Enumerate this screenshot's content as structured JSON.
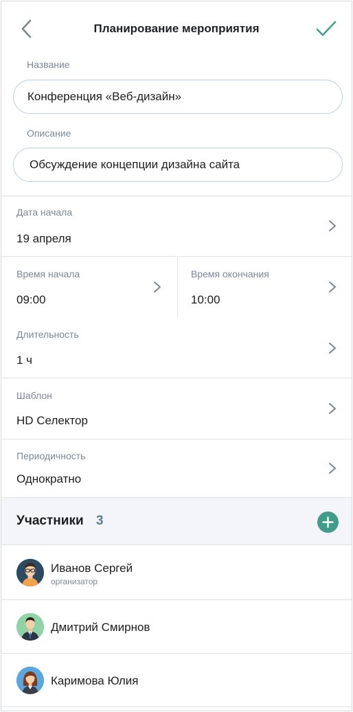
{
  "header": {
    "title": "Планирование мероприятия"
  },
  "form": {
    "name_label": "Название",
    "name_value": "Конференция «Веб-дизайн»",
    "description_label": "Описание",
    "description_value": "Обсуждение концепции дизайна сайта"
  },
  "rows": {
    "start_date_label": "Дата начала",
    "start_date_value": "19 апреля",
    "start_time_label": "Время начала",
    "start_time_value": "09:00",
    "end_time_label": "Время окончания",
    "end_time_value": "10:00",
    "duration_label": "Длительность",
    "duration_value": "1 ч",
    "template_label": "Шаблон",
    "template_value": "HD Селектор",
    "recurrence_label": "Периодичность",
    "recurrence_value": "Однократно"
  },
  "participants": {
    "title": "Участники",
    "count": "3",
    "items": [
      {
        "name": "Иванов Сергей",
        "role": "организатор",
        "avatar": "avatar-man-glasses"
      },
      {
        "name": "Дмитрий Смирнов",
        "role": "",
        "avatar": "avatar-man-suit"
      },
      {
        "name": "Каримова Юлия",
        "role": "",
        "avatar": "avatar-woman"
      }
    ]
  },
  "colors": {
    "accent": "#3f9d89",
    "label": "#7b8794",
    "count": "#5b7d96",
    "input_border": "#b9cfe3",
    "section_bg": "#f3f5f8"
  }
}
